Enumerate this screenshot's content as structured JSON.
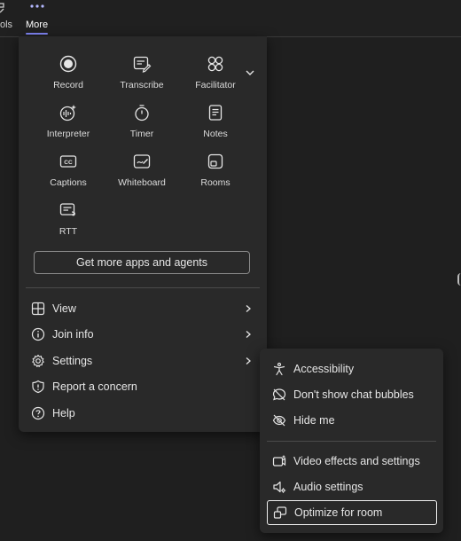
{
  "tabs": {
    "tools_label": "ols",
    "more_label": "More"
  },
  "more_menu": {
    "grid": [
      {
        "label": "Record",
        "icon": "record-icon"
      },
      {
        "label": "Transcribe",
        "icon": "transcribe-icon"
      },
      {
        "label": "Facilitator",
        "icon": "facilitator-icon"
      },
      {
        "label": "Interpreter",
        "icon": "interpreter-icon"
      },
      {
        "label": "Timer",
        "icon": "timer-icon"
      },
      {
        "label": "Notes",
        "icon": "notes-icon"
      },
      {
        "label": "Captions",
        "icon": "captions-icon"
      },
      {
        "label": "Whiteboard",
        "icon": "whiteboard-icon"
      },
      {
        "label": "Rooms",
        "icon": "rooms-icon"
      },
      {
        "label": "RTT",
        "icon": "rtt-icon"
      }
    ],
    "get_apps_label": "Get more apps and agents",
    "items": [
      {
        "label": "View",
        "icon": "view-grid-icon",
        "has_submenu": true
      },
      {
        "label": "Join info",
        "icon": "info-icon",
        "has_submenu": true
      },
      {
        "label": "Settings",
        "icon": "gear-icon",
        "has_submenu": true
      },
      {
        "label": "Report a concern",
        "icon": "shield-alert-icon",
        "has_submenu": false
      },
      {
        "label": "Help",
        "icon": "help-icon",
        "has_submenu": false
      }
    ]
  },
  "settings_submenu": {
    "items": [
      {
        "label": "Accessibility",
        "icon": "accessibility-icon"
      },
      {
        "label": "Don't show chat bubbles",
        "icon": "chat-off-icon"
      },
      {
        "label": "Hide me",
        "icon": "eye-off-icon"
      },
      {
        "label": "Video effects and settings",
        "icon": "video-effects-icon"
      },
      {
        "label": "Audio settings",
        "icon": "speaker-settings-icon"
      },
      {
        "label": "Optimize for room",
        "icon": "optimize-room-icon"
      }
    ],
    "focused_item": "Optimize for room"
  },
  "colors": {
    "background": "#1f1f1f",
    "menu_surface": "#292929",
    "accent": "#7f85f5",
    "text": "#e6e6e6"
  }
}
